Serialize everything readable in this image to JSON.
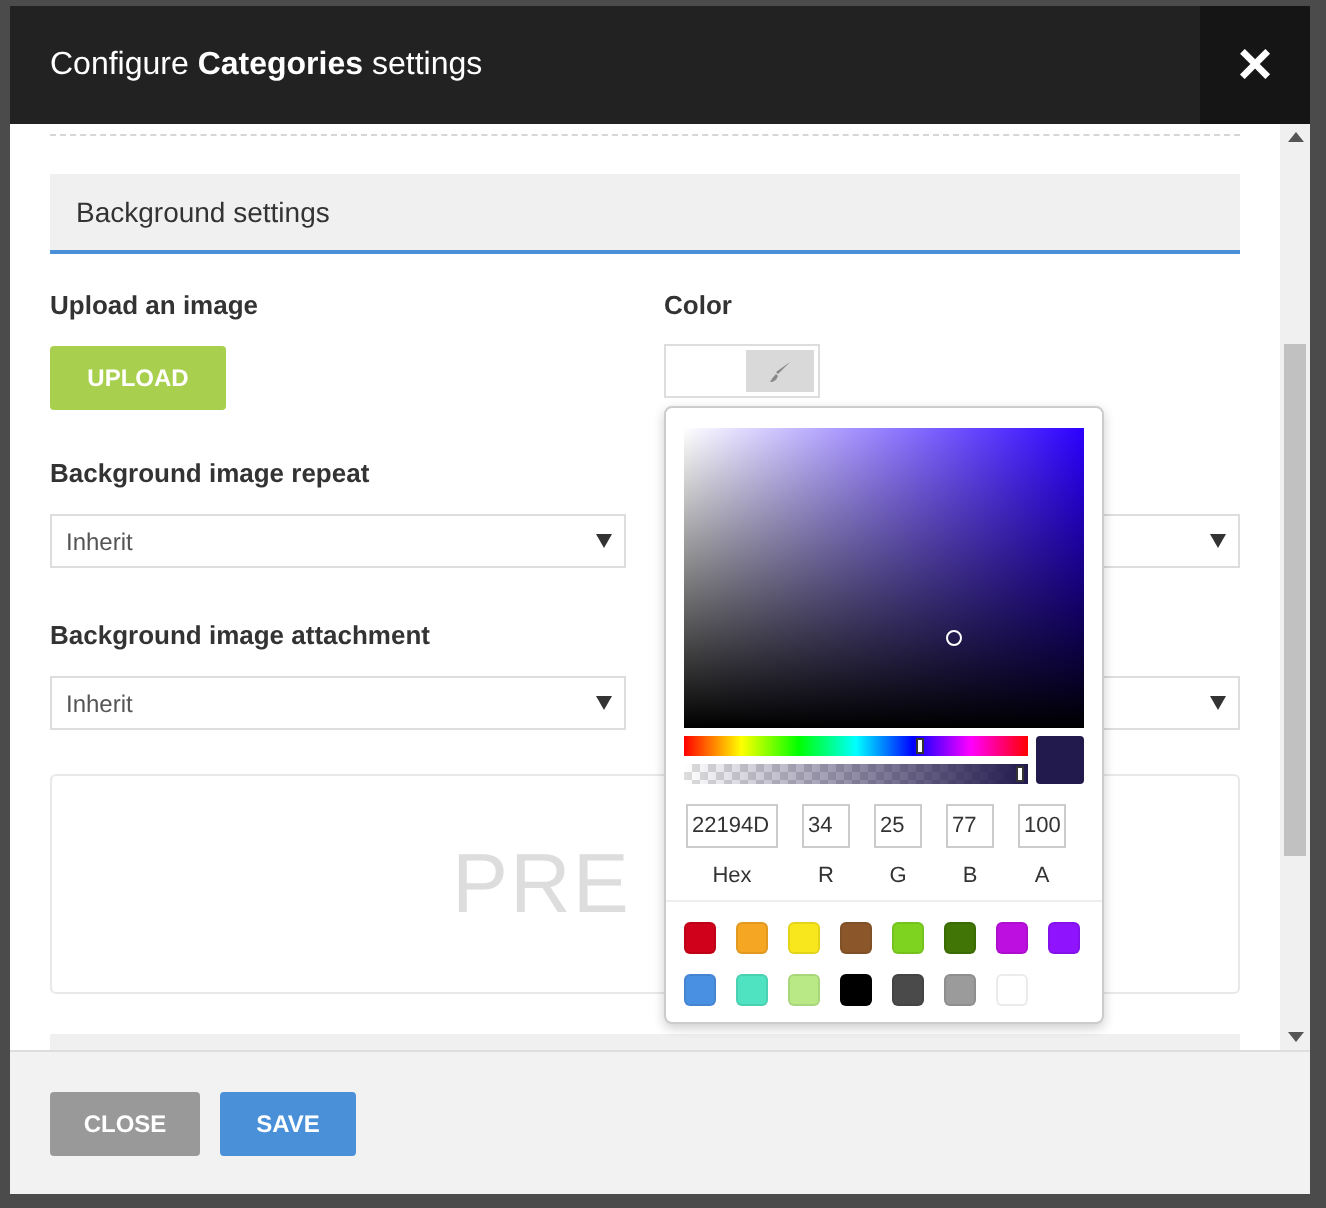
{
  "dialog": {
    "title": "Configure **Categories** settings",
    "close_icon": "×"
  },
  "section": {
    "title": "Background settings"
  },
  "upload": {
    "label": "Upload an image",
    "button": "UPLOAD"
  },
  "color": {
    "label": "Color"
  },
  "fields": [
    {
      "label": "Background image repeat",
      "value": "Inherit"
    },
    {
      "label": "Background image attachment",
      "value": "Inherit"
    }
  ],
  "preview": {
    "text": "PRE"
  },
  "picker": {
    "hue": {
      "level": 0.69
    },
    "alpha": {
      "level": 1
    },
    "hex": "22194D",
    "r": "34",
    "g": "25",
    "b": "77",
    "a": "100",
    "labels": [
      "Hex",
      "R",
      "G",
      "B",
      "A"
    ],
    "swatches": [
      {
        "color": "#d0021b"
      },
      {
        "color": "#f5a623"
      },
      {
        "color": "#f8e71c"
      },
      {
        "color": "#8b572a"
      },
      {
        "color": "#7ed321"
      },
      {
        "color": "#417505"
      },
      {
        "color": "#bd10e0"
      },
      {
        "color": "#9013fe"
      },
      {
        "color": "#4a90e2"
      },
      {
        "color": "#50e3c2"
      },
      {
        "color": "#b8e986"
      },
      {
        "color": "#000000"
      },
      {
        "color": "#4a4a4a"
      },
      {
        "color": "#9b9b9b"
      },
      {
        "color": "#ffffff"
      }
    ]
  },
  "footer": {
    "buttons": [
      {
        "kind": "close",
        "label": "CLOSE"
      },
      {
        "kind": "save",
        "label": "SAVE"
      }
    ]
  }
}
